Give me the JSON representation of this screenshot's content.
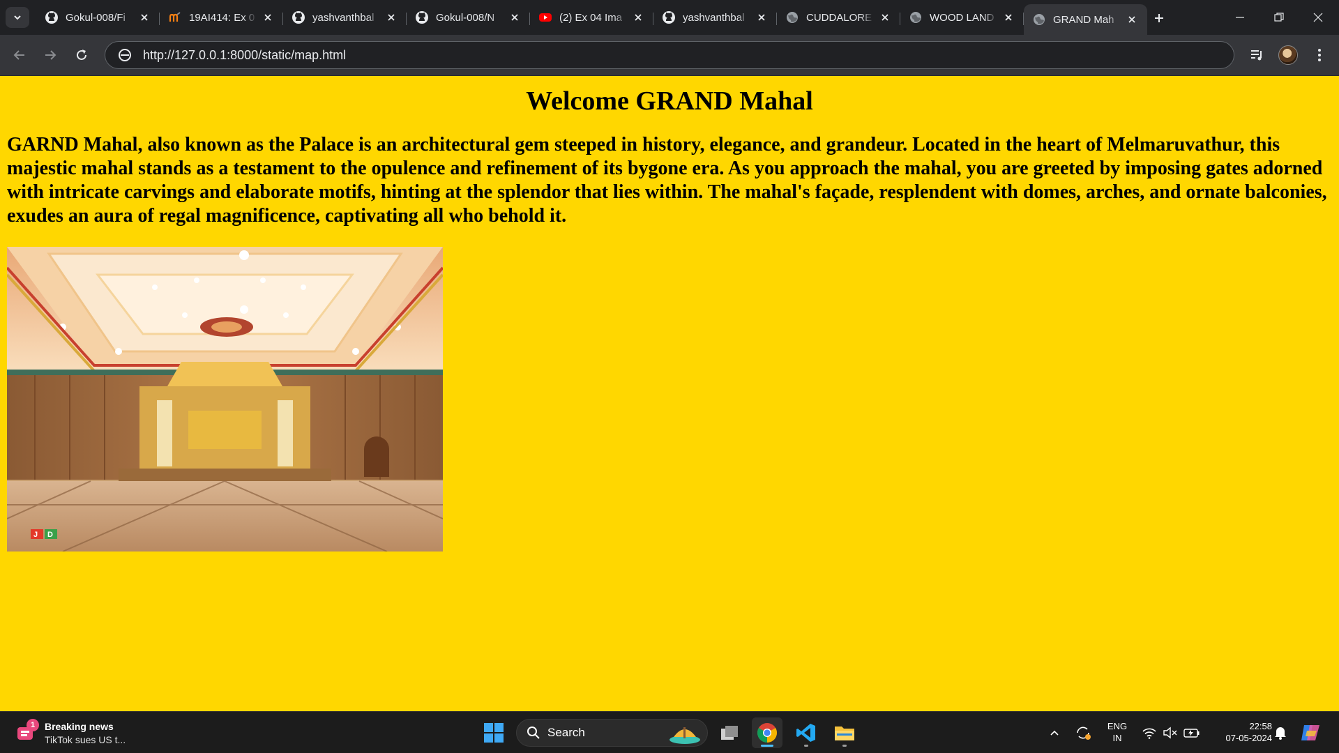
{
  "browser": {
    "tabs": [
      {
        "title": "Gokul-008/Fi",
        "icon": "github-icon",
        "active": false
      },
      {
        "title": "19AI414: Ex 0",
        "icon": "moodle-icon",
        "active": false
      },
      {
        "title": "yashvanthbal",
        "icon": "github-icon",
        "active": false
      },
      {
        "title": "Gokul-008/N",
        "icon": "github-icon",
        "active": false
      },
      {
        "title": "(2) Ex 04 Ima",
        "icon": "youtube-icon",
        "active": false
      },
      {
        "title": "yashvanthbal",
        "icon": "github-icon",
        "active": false
      },
      {
        "title": "CUDDALORE",
        "icon": "globe-icon",
        "active": false
      },
      {
        "title": "WOOD LAND",
        "icon": "globe-icon",
        "active": false
      },
      {
        "title": "GRAND Mah",
        "icon": "globe-icon",
        "active": true
      }
    ],
    "url": "http://127.0.0.1:8000/static/map.html"
  },
  "page": {
    "background": "#ffd700",
    "title": "Welcome GRAND Mahal",
    "description": "GARND Mahal, also known as the Palace is an architectural gem steeped in history, elegance, and grandeur. Located in the heart of Melmaruvathur, this majestic mahal stands as a testament to the opulence and refinement of its bygone era. As you approach the mahal, you are greeted by imposing gates adorned with intricate carvings and elaborate motifs, hinting at the splendor that lies within. The mahal's façade, resplendent with domes, arches, and ornate balconies, exudes an aura of regal magnificence, captivating all who behold it.",
    "image_logo": "JD"
  },
  "taskbar": {
    "news_title": "Breaking news",
    "news_text": "TikTok sues US t...",
    "news_badge": "1",
    "search_label": "Search",
    "lang_line1": "ENG",
    "lang_line2": "IN",
    "time": "22:58",
    "date": "07-05-2024"
  }
}
